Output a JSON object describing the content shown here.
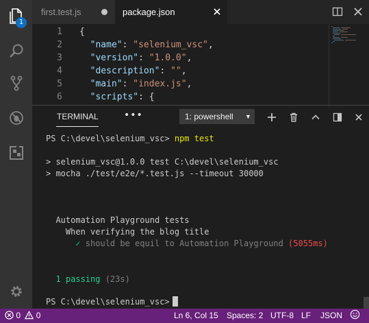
{
  "activity_bar": {
    "badge_count": "1",
    "items": [
      "explorer-icon",
      "search-icon",
      "source-control-icon",
      "debug-icon",
      "extensions-icon"
    ],
    "bottom": "gear-icon"
  },
  "tabs": [
    {
      "label": "first.test.js",
      "dirty": true,
      "active": false
    },
    {
      "label": "package.json",
      "dirty": false,
      "active": true
    }
  ],
  "editor": {
    "lines": [
      {
        "n": "1",
        "parts": [
          {
            "t": "{",
            "c": "p"
          }
        ]
      },
      {
        "n": "2",
        "parts": [
          {
            "t": "  ",
            "c": "p"
          },
          {
            "t": "\"name\"",
            "c": "k"
          },
          {
            "t": ": ",
            "c": "p"
          },
          {
            "t": "\"selenium_vsc\"",
            "c": "s"
          },
          {
            "t": ",",
            "c": "p"
          }
        ]
      },
      {
        "n": "3",
        "parts": [
          {
            "t": "  ",
            "c": "p"
          },
          {
            "t": "\"version\"",
            "c": "k"
          },
          {
            "t": ": ",
            "c": "p"
          },
          {
            "t": "\"1.0.0\"",
            "c": "s"
          },
          {
            "t": ",",
            "c": "p"
          }
        ]
      },
      {
        "n": "4",
        "parts": [
          {
            "t": "  ",
            "c": "p"
          },
          {
            "t": "\"description\"",
            "c": "k"
          },
          {
            "t": ": ",
            "c": "p"
          },
          {
            "t": "\"\"",
            "c": "s"
          },
          {
            "t": ",",
            "c": "p"
          }
        ]
      },
      {
        "n": "5",
        "parts": [
          {
            "t": "  ",
            "c": "p"
          },
          {
            "t": "\"main\"",
            "c": "k"
          },
          {
            "t": ": ",
            "c": "p"
          },
          {
            "t": "\"index.js\"",
            "c": "s"
          },
          {
            "t": ",",
            "c": "p"
          }
        ]
      },
      {
        "n": "6",
        "parts": [
          {
            "t": "  ",
            "c": "p"
          },
          {
            "t": "\"scripts\"",
            "c": "k"
          },
          {
            "t": ": {",
            "c": "p"
          }
        ]
      }
    ]
  },
  "panel": {
    "title": "TERMINAL",
    "more": "•••",
    "terminal_select": "1: powershell",
    "actions": [
      "plus-icon",
      "trash-icon",
      "chevron-up-icon",
      "maximize-icon",
      "close-icon"
    ]
  },
  "terminal": {
    "prompt1": "PS C:\\devel\\selenium_vsc> ",
    "cmd1": "npm test",
    "out1": "> selenium_vsc@1.0.0 test C:\\devel\\selenium_vsc",
    "out2": "> mocha ./test/e2e/*.test.js --timeout 30000",
    "suite": "  Automation Playground tests",
    "subsuite": "    When verifying the blog title",
    "check": "      ✓",
    "test_name": " should be equil to Automation Playground",
    "duration": " (5055ms)",
    "passing": "  1 passing",
    "passing_time": " (23s)",
    "prompt2": "PS C:\\devel\\selenium_vsc>"
  },
  "status_bar": {
    "errors": "0",
    "warnings": "0",
    "position": "Ln 6, Col 15",
    "spaces": "Spaces: 2",
    "encoding": "UTF-8",
    "eol": "LF",
    "language": "JSON"
  },
  "colors": {
    "status_bar": "#68217a",
    "activity_bar": "#333333",
    "badge": "#0e70c0",
    "json_key": "#9cdcfe",
    "json_string": "#ce9178"
  }
}
